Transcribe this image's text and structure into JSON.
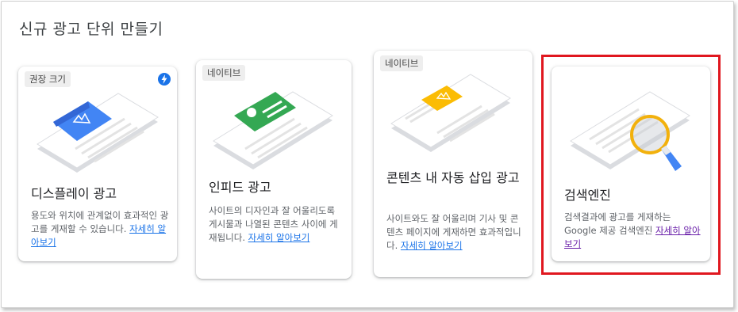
{
  "header": {
    "title": "신규 광고 단위 만들기"
  },
  "cards": [
    {
      "badge": "권장 크기",
      "title": "디스플레이 광고",
      "desc": "용도와 위치에 관계없이 효과적인 광고를 게재할 수 있습니다. ",
      "link": "자세히 알아보기"
    },
    {
      "badge": "네이티브",
      "title": "인피드 광고",
      "desc": "사이트의 디자인과 잘 어울리도록 게시물과 나열된 콘텐츠 사이에 게재됩니다. ",
      "link": "자세히 알아보기"
    },
    {
      "badge": "네이티브",
      "title": "콘텐츠 내 자동 삽입 광고",
      "desc": "사이트와도 잘 어울리며 기사 및 콘텐츠 페이지에 게재하면 효과적입니다. ",
      "link": "자세히 알아보기"
    },
    {
      "badge": "",
      "title": "검색엔진",
      "desc": "검색결과에 광고를 게재하는 Google 제공 검색엔진 ",
      "link": "자세히 알아보기"
    }
  ],
  "colors": {
    "display_ad": "#4285f4",
    "infeed_ad": "#34a853",
    "inarticle_ad": "#fbbc04",
    "search_lens": "#f2b10d",
    "highlight": "#e0171f",
    "link": "#1a73e8",
    "link_visited": "#681da8"
  },
  "icons": {
    "recommended": "lightning-bolt-icon"
  }
}
